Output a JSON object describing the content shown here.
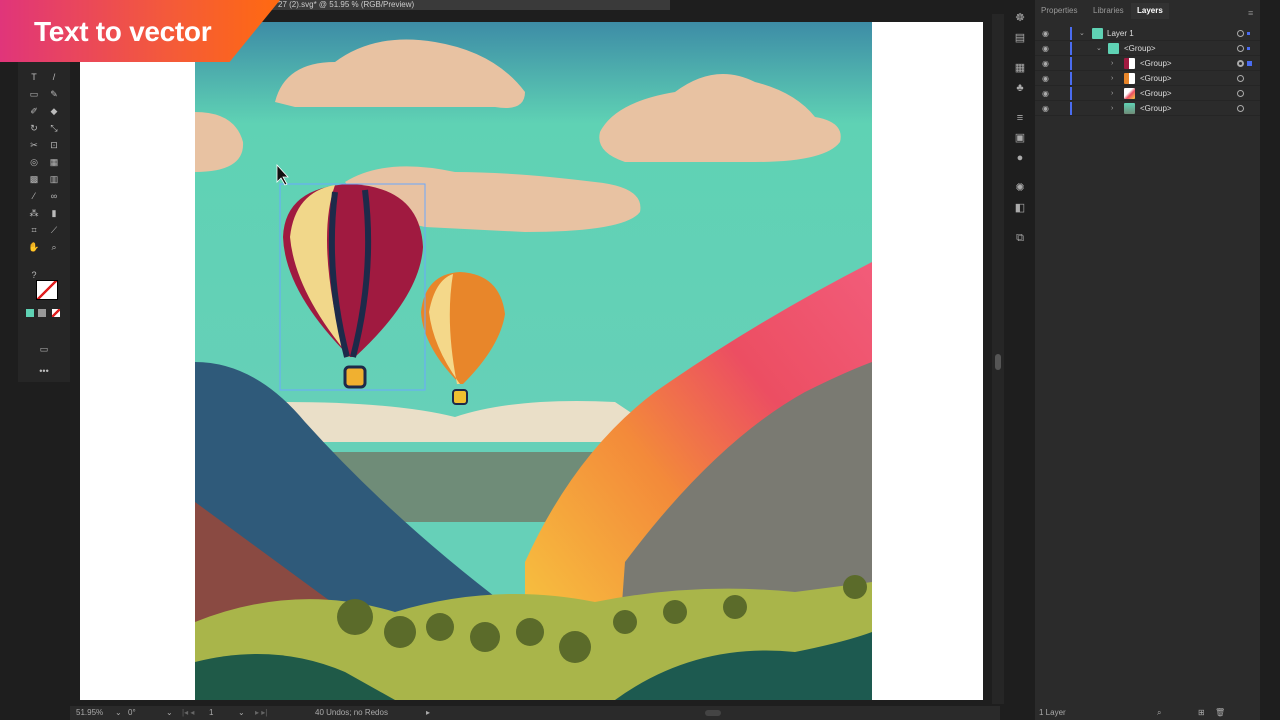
{
  "banner": {
    "text": "Text to vector"
  },
  "document": {
    "tab_title": "27 (2).svg* @ 51.95 % (RGB/Preview)"
  },
  "panel": {
    "tabs": [
      {
        "label": "Properties"
      },
      {
        "label": "Libraries"
      },
      {
        "label": "Layers",
        "active": true
      }
    ],
    "layers": [
      {
        "name": "Layer 1",
        "level": 0,
        "expanded": true
      },
      {
        "name": "<Group>",
        "level": 1,
        "expanded": true
      },
      {
        "name": "<Group>",
        "level": 2,
        "expanded": false,
        "selected": true
      },
      {
        "name": "<Group>",
        "level": 2,
        "expanded": false
      },
      {
        "name": "<Group>",
        "level": 2,
        "expanded": false
      },
      {
        "name": "<Group>",
        "level": 2,
        "expanded": false
      }
    ],
    "layer_count": "1 Layer"
  },
  "status": {
    "zoom": "51.95%",
    "rotation": "0°",
    "artboard": "1",
    "undo_info": "40 Undos; no Redos"
  },
  "colors": {
    "accent": "#4a6cf0",
    "sky_top": "#3d8ca6",
    "sky": "#5fd2b4",
    "cloud": "#e8c2a2"
  }
}
